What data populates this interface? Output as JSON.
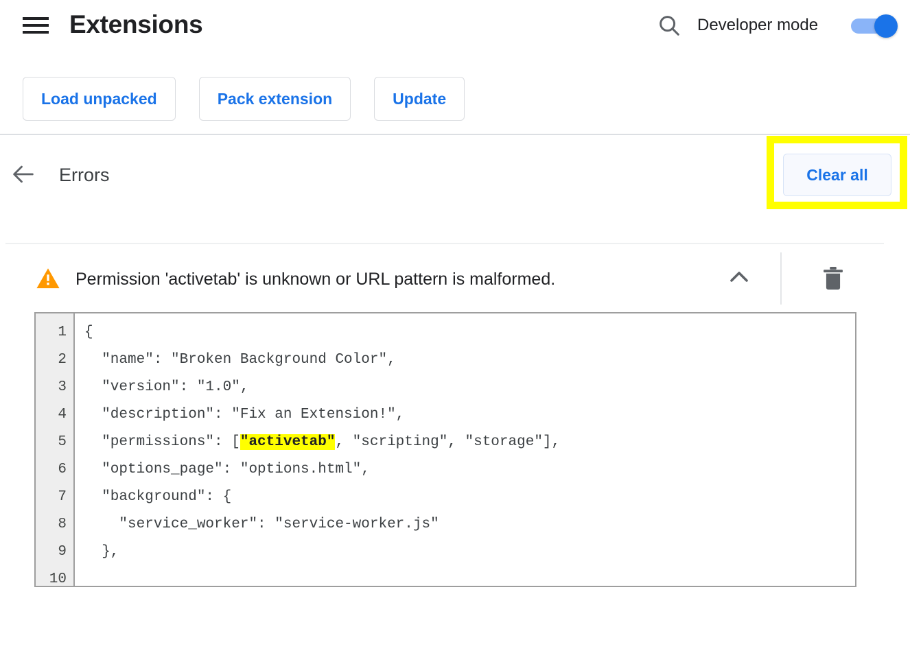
{
  "toolbar": {
    "menu_icon": "hamburger-menu-icon",
    "title": "Extensions",
    "search_icon": "search-icon",
    "developer_mode_label": "Developer mode",
    "developer_mode_on": true
  },
  "actions": [
    {
      "label": "Load unpacked",
      "name": "load-unpacked-button"
    },
    {
      "label": "Pack extension",
      "name": "pack-extension-button"
    },
    {
      "label": "Update",
      "name": "update-button"
    }
  ],
  "errors_header": {
    "back_icon": "back-arrow-icon",
    "title": "Errors",
    "clear_all_label": "Clear all"
  },
  "error_item": {
    "severity_icon": "warning-triangle-icon",
    "message": "Permission 'activetab' is unknown or URL pattern is malformed.",
    "collapse_icon": "chevron-up-icon",
    "delete_icon": "trash-icon"
  },
  "code": {
    "line_numbers": [
      "1",
      "2",
      "3",
      "4",
      "5",
      "6",
      "7",
      "8",
      "9",
      "10"
    ],
    "lines": [
      "{",
      "  \"name\": \"Broken Background Color\",",
      "  \"version\": \"1.0\",",
      "  \"description\": \"Fix an Extension!\",",
      "  \"permissions\": [",
      "  \"options_page\": \"options.html\",",
      "  \"background\": {",
      "    \"service_worker\": \"service-worker.js\"",
      "  },",
      ""
    ],
    "highlight_line_index": 4,
    "highlight_prefix": "  \"permissions\": [",
    "highlight_token": "\"activetab\"",
    "highlight_suffix": ", \"scripting\", \"storage\"],"
  },
  "colors": {
    "accent_blue": "#1a73e8",
    "toggle_track": "#8ab4f8",
    "warning_orange": "#ff9800",
    "highlight_yellow": "#ffff00",
    "border_gray": "#dadce0"
  }
}
